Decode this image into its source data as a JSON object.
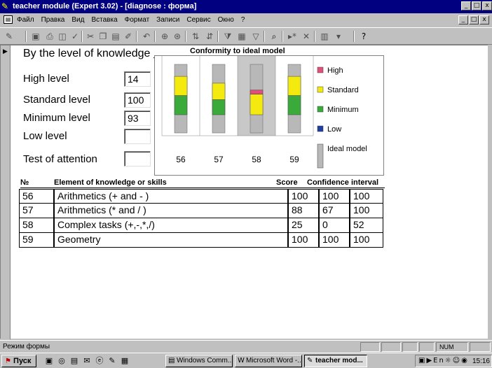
{
  "window": {
    "title": "teacher module (Expert 3.02) - [diagnose : форма]",
    "buttons": {
      "minimize": "_",
      "maximize": "□",
      "close": "x"
    }
  },
  "menu": [
    "Файл",
    "Правка",
    "Вид",
    "Вставка",
    "Формат",
    "Записи",
    "Сервис",
    "Окно",
    "?"
  ],
  "form": {
    "knowledge_title": "By the level of knowledge",
    "fields": [
      {
        "label": "High level",
        "value": "14"
      },
      {
        "label": "Standard level",
        "value": "100"
      },
      {
        "label": "Minimum level",
        "value": "93"
      },
      {
        "label": "Low level",
        "value": ""
      },
      {
        "label": "Test of attention",
        "value": ""
      }
    ]
  },
  "chart_data": {
    "type": "bar",
    "title": "Conformity to ideal model",
    "categories": [
      "56",
      "57",
      "58",
      "59"
    ],
    "series": [
      {
        "name": "Low",
        "color": "#1f3fa0",
        "values": [
          0,
          0,
          0,
          0
        ]
      },
      {
        "name": "Minimum",
        "color": "#3aaa3a",
        "values": [
          28,
          22,
          0,
          28
        ]
      },
      {
        "name": "Standard",
        "color": "#f5ea10",
        "values": [
          28,
          24,
          30,
          28
        ]
      },
      {
        "name": "High",
        "color": "#e0507a",
        "values": [
          0,
          0,
          6,
          0
        ]
      },
      {
        "name": "Ideal model",
        "color": "#b8b8b8",
        "values": [
          100,
          100,
          100,
          100
        ]
      }
    ],
    "legend_order": [
      "High",
      "Standard",
      "Minimum",
      "Low",
      "Ideal model"
    ],
    "highlighted_category": "58",
    "ylim": [
      0,
      100
    ],
    "legend": "right"
  },
  "table": {
    "headers": {
      "number": "№",
      "element": "Element of knowledge or skills",
      "score": "Score",
      "confidence": "Confidence interval"
    },
    "rows": [
      {
        "number": "56",
        "element": "Arithmetics (+ and - )",
        "score": "100",
        "lo": "100",
        "hi": "100"
      },
      {
        "number": "57",
        "element": "Arithmetics (* and / )",
        "score": "88",
        "lo": "67",
        "hi": "100"
      },
      {
        "number": "58",
        "element": "Complex tasks (+,-,*,/)",
        "score": "25",
        "lo": "0",
        "hi": "52"
      },
      {
        "number": "59",
        "element": "Geometry",
        "score": "100",
        "lo": "100",
        "hi": "100"
      }
    ]
  },
  "status": {
    "text": "Режим формы",
    "num": "NUM"
  },
  "taskbar": {
    "start": "Пуск",
    "tasks": [
      {
        "label": "Windows Comm...",
        "active": false
      },
      {
        "label": "Microsoft Word -...",
        "active": false
      },
      {
        "label": "teacher mod...",
        "active": true
      }
    ],
    "clock": "15:16",
    "tray_lang": "En"
  }
}
